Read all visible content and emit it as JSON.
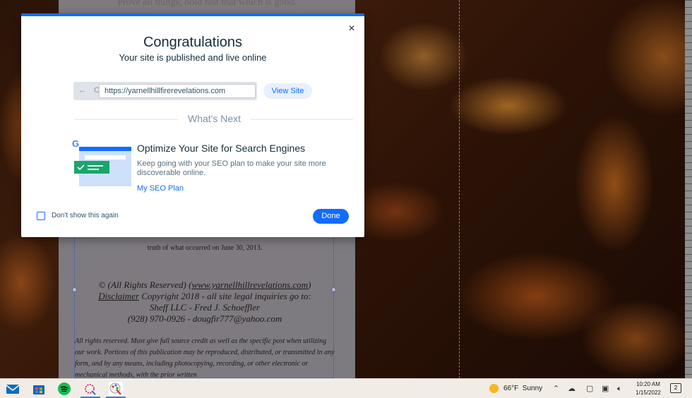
{
  "background": {
    "motto": "Prove all things; hold fast that which is good.",
    "page_text": {
      "date_line": "truth of what occurred on June 30, 2013.",
      "copyright_line1_prefix": "© (All Rights Reserved) (",
      "copyright_link": "www.yarnellhillrevelations.com",
      "copyright_line1_suffix": ")",
      "disclaimer": "Disclaimer",
      "copyright_line2_rest": " Copyright 2018 -   all site legal inquiries go to:",
      "copyright_line3": "Sheff LLC - Fred J. Schoeffler",
      "copyright_line4": "(928) 970-0926 - dougfir777@yahoo.com",
      "rights_text": "All rights reserved. Must give full source credit as well as the specific post when utilizing our work. Portions of this publication may be reproduced, distributed, or transmitted in any form, and by any means, including photocopying, recording, or other electronic or mechanical methods, with the prior written"
    }
  },
  "modal": {
    "close_icon": "×",
    "title": "Congratulations",
    "subtitle": "Your site is published and live online",
    "browser": {
      "nav_arrows": "← C",
      "url": "https://yarnellhillfirerevelations.com"
    },
    "view_site_label": "View Site",
    "whats_next_label": "What's Next",
    "seo": {
      "google_letter": "G",
      "title": "Optimize Your Site for Search Engines",
      "description": "Keep going with your SEO plan to make your site more discoverable online.",
      "link_label": "My SEO Plan"
    },
    "dont_show_label": "Don't show this again",
    "done_label": "Done"
  },
  "taskbar": {
    "apps": [
      "mail-icon",
      "store-icon",
      "spotify-icon",
      "snipping-tool-icon",
      "paint-icon"
    ],
    "weather": {
      "temp": "66°F",
      "condition": "Sunny"
    },
    "clock": {
      "time": "10:20 AM",
      "date": "1/15/2022"
    },
    "notification_count": "2",
    "colors": {
      "accent": "#116dff",
      "taskbar_bg": "#f1ede6"
    }
  }
}
